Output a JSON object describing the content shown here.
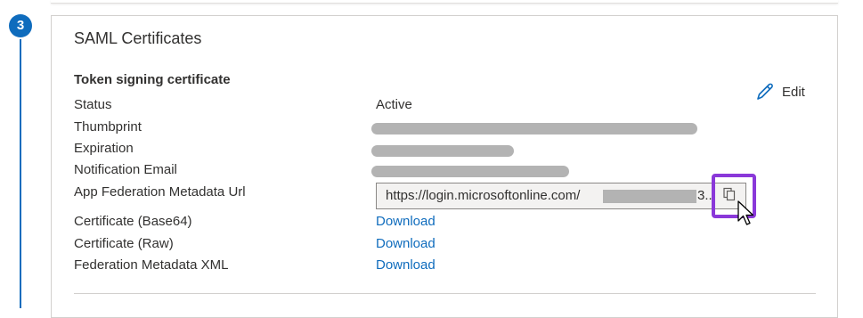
{
  "step": {
    "number": "3"
  },
  "card": {
    "title": "SAML Certificates",
    "section_heading": "Token signing certificate",
    "edit_label": "Edit",
    "rows": [
      {
        "label": "Status",
        "value": "Active"
      },
      {
        "label": "Thumbprint",
        "value": ""
      },
      {
        "label": "Expiration",
        "value": ""
      },
      {
        "label": "Notification Email",
        "value": ""
      },
      {
        "label": "App Federation Metadata Url",
        "value": "https://login.microsoftonline.com/"
      },
      {
        "label": "Certificate (Base64)",
        "value": "Download"
      },
      {
        "label": "Certificate (Raw)",
        "value": "Download"
      },
      {
        "label": "Federation Metadata XML",
        "value": "Download"
      }
    ],
    "url_tail": "3.."
  },
  "colors": {
    "accent": "#0f6cbd",
    "highlight": "#8a38d9",
    "redaction": "#b3b3b3"
  },
  "icons": {
    "edit": "pencil-icon",
    "copy": "copy-icon",
    "cursor": "mouse-pointer-icon"
  }
}
